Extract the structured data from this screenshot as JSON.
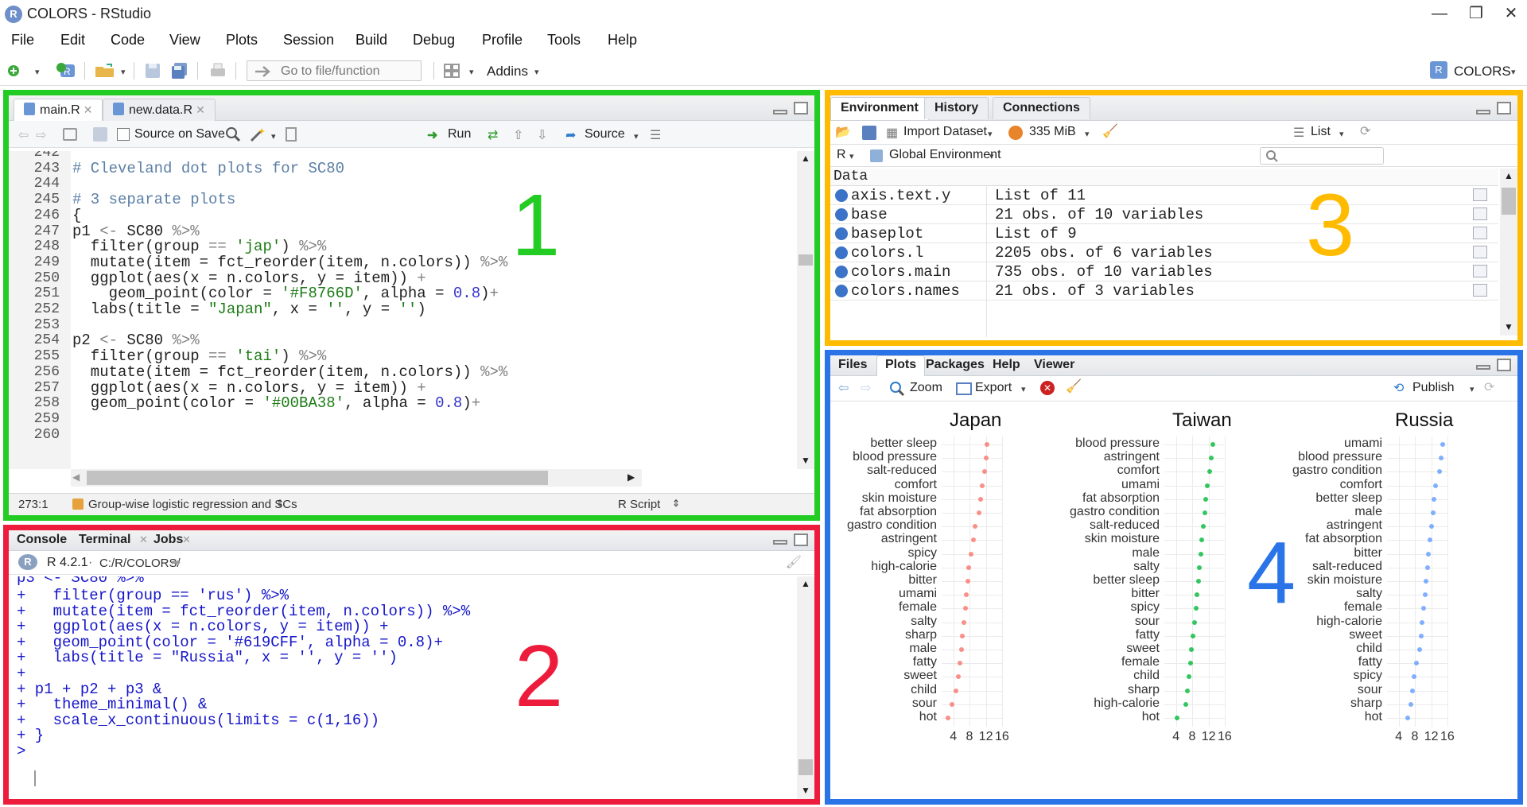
{
  "window": {
    "title": "COLORS - RStudio",
    "app_icon": "R"
  },
  "menu": [
    "File",
    "Edit",
    "Code",
    "View",
    "Plots",
    "Session",
    "Build",
    "Debug",
    "Profile",
    "Tools",
    "Help"
  ],
  "toolbar": {
    "goto_placeholder": "Go to file/function",
    "addins": "Addins",
    "project": "COLORS"
  },
  "editor": {
    "tabs": [
      "main.R",
      "new.data.R"
    ],
    "source_on_save": "Source on Save",
    "run": "Run",
    "source": "Source",
    "lines": [
      {
        "n": "242",
        "t": ""
      },
      {
        "n": "243",
        "t": "# Cleveland dot plots for SC80"
      },
      {
        "n": "244",
        "t": ""
      },
      {
        "n": "245",
        "t": "# 3 separate plots"
      },
      {
        "n": "246",
        "t": "{"
      },
      {
        "n": "247",
        "t": "p1 <- SC80 %>%"
      },
      {
        "n": "248",
        "t": "  filter(group == 'jap') %>%"
      },
      {
        "n": "249",
        "t": "  mutate(item = fct_reorder(item, n.colors)) %>%"
      },
      {
        "n": "250",
        "t": "  ggplot(aes(x = n.colors, y = item)) +"
      },
      {
        "n": "251",
        "t": "    geom_point(color = '#F8766D', alpha = 0.8)+"
      },
      {
        "n": "252",
        "t": "  labs(title = \"Japan\", x = '', y = '')"
      },
      {
        "n": "253",
        "t": ""
      },
      {
        "n": "254",
        "t": "p2 <- SC80 %>%"
      },
      {
        "n": "255",
        "t": "  filter(group == 'tai') %>%"
      },
      {
        "n": "256",
        "t": "  mutate(item = fct_reorder(item, n.colors)) %>%"
      },
      {
        "n": "257",
        "t": "  ggplot(aes(x = n.colors, y = item)) +"
      },
      {
        "n": "258",
        "t": "  geom_point(color = '#00BA38', alpha = 0.8)+"
      },
      {
        "n": "259",
        "t": ""
      },
      {
        "n": "260",
        "t": ""
      }
    ],
    "status_pos": "273:1",
    "status_scope": "Group-wise logistic regression and SCs",
    "status_type": "R Script",
    "pane_number": "1"
  },
  "console": {
    "tabs": [
      "Console",
      "Terminal",
      "Jobs"
    ],
    "version": "R 4.2.1",
    "path": "C:/R/COLORS/",
    "lines": [
      "+   filter(group == 'rus') %>%",
      "+   mutate(item = fct_reorder(item, n.colors)) %>%",
      "+   ggplot(aes(x = n.colors, y = item)) +",
      "+   geom_point(color = '#619CFF', alpha = 0.8)+",
      "+   labs(title = \"Russia\", x = '', y = '')",
      "+",
      "+ p1 + p2 + p3 &",
      "+   theme_minimal() &",
      "+   scale_x_continuous(limits = c(1,16))",
      "+ }",
      ">"
    ],
    "pane_number": "2"
  },
  "environment": {
    "tabs": [
      "Environment",
      "History",
      "Connections"
    ],
    "import_dataset": "Import Dataset",
    "memory": "335 MiB",
    "view_mode": "List",
    "lang": "R",
    "scope": "Global Environment",
    "section": "Data",
    "rows": [
      {
        "name": "axis.text.y",
        "value": "List of  11"
      },
      {
        "name": "base",
        "value": "21 obs. of 10 variables"
      },
      {
        "name": "baseplot",
        "value": "List of  9"
      },
      {
        "name": "colors.l",
        "value": "2205 obs. of 6 variables"
      },
      {
        "name": "colors.main",
        "value": "735 obs. of 10 variables"
      },
      {
        "name": "colors.names",
        "value": "21 obs. of 3 variables"
      }
    ],
    "pane_number": "3"
  },
  "files": {
    "tabs": [
      "Files",
      "Plots",
      "Packages",
      "Help",
      "Viewer"
    ],
    "zoom": "Zoom",
    "export": "Export",
    "publish": "Publish",
    "pane_number": "4"
  },
  "colors": {
    "japan": "#F8766D",
    "taiwan": "#00BA38",
    "russia": "#619CFF",
    "green": "#22cc22",
    "red": "#ee1c3c",
    "orange": "#ffbb00",
    "blue": "#2a74e8"
  },
  "chart_data": [
    {
      "type": "scatter",
      "title": "Japan",
      "xlim": [
        1,
        16
      ],
      "xticks": [
        4,
        8,
        12,
        16
      ],
      "categories": [
        "better sleep",
        "blood pressure",
        "salt-reduced",
        "comfort",
        "skin moisture",
        "fat absorption",
        "gastro condition",
        "astringent",
        "spicy",
        "high-calorie",
        "bitter",
        "umami",
        "female",
        "salty",
        "sharp",
        "male",
        "fatty",
        "sweet",
        "child",
        "sour",
        "hot"
      ],
      "values": [
        12.3,
        12.0,
        11.7,
        11.0,
        10.6,
        10.2,
        9.3,
        8.8,
        8.3,
        7.8,
        7.5,
        7.2,
        6.9,
        6.6,
        6.2,
        5.9,
        5.5,
        5.2,
        4.5,
        3.6,
        2.5
      ]
    },
    {
      "type": "scatter",
      "title": "Taiwan",
      "xlim": [
        1,
        16
      ],
      "xticks": [
        4,
        8,
        12,
        16
      ],
      "categories": [
        "blood pressure",
        "astringent",
        "comfort",
        "umami",
        "fat absorption",
        "gastro condition",
        "salt-reduced",
        "skin moisture",
        "male",
        "salty",
        "better sleep",
        "bitter",
        "spicy",
        "sour",
        "fatty",
        "sweet",
        "female",
        "child",
        "sharp",
        "high-calorie",
        "hot"
      ],
      "values": [
        13.0,
        12.6,
        12.2,
        11.7,
        11.3,
        11.0,
        10.7,
        10.3,
        10.0,
        9.7,
        9.4,
        9.1,
        8.8,
        8.5,
        8.2,
        7.8,
        7.5,
        7.2,
        6.8,
        6.3,
        4.2
      ]
    },
    {
      "type": "scatter",
      "title": "Russia",
      "xlim": [
        1,
        16
      ],
      "xticks": [
        4,
        8,
        12,
        16
      ],
      "categories": [
        "umami",
        "blood pressure",
        "gastro condition",
        "comfort",
        "better sleep",
        "male",
        "astringent",
        "fat absorption",
        "bitter",
        "salt-reduced",
        "skin moisture",
        "salty",
        "female",
        "high-calorie",
        "sweet",
        "child",
        "fatty",
        "spicy",
        "sour",
        "sharp",
        "hot"
      ],
      "values": [
        14.8,
        14.5,
        14.0,
        13.1,
        12.7,
        12.4,
        12.0,
        11.7,
        11.3,
        11.0,
        10.7,
        10.4,
        10.1,
        9.7,
        9.4,
        9.0,
        8.4,
        7.8,
        7.3,
        6.9,
        6.2
      ]
    }
  ]
}
